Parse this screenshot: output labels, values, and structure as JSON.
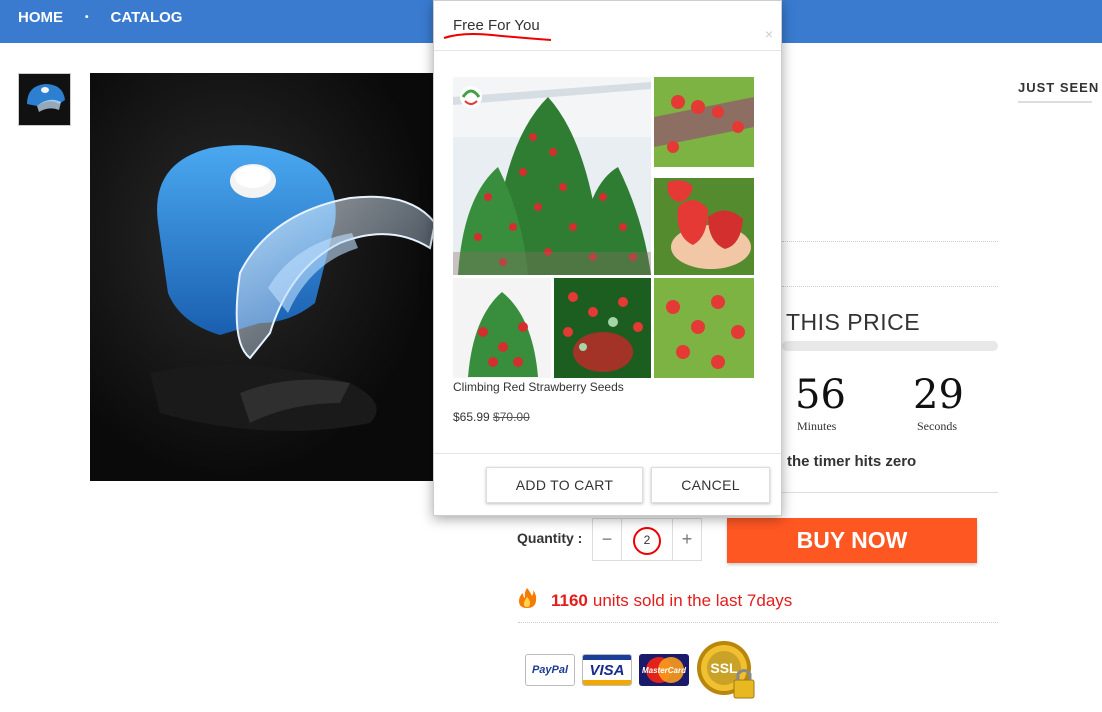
{
  "nav": {
    "home": "HOME",
    "separator": "•",
    "catalog": "CATALOG"
  },
  "sidebar": {
    "just_seen": "JUST SEEN"
  },
  "promo": {
    "title": "THIS PRICE",
    "timer": [
      {
        "value": "56",
        "label": "Minutes"
      },
      {
        "value": "29",
        "label": "Seconds"
      }
    ],
    "note": "the timer hits zero"
  },
  "quantity": {
    "label": "Quantity :",
    "minus": "−",
    "value": "2",
    "plus": "+"
  },
  "buy_button": "BUY NOW",
  "sold": {
    "count": "1160",
    "text": "units sold in the last 7days"
  },
  "payment_badges": {
    "paypal": "PayPal",
    "visa": "VISA",
    "mastercard": "MasterCard",
    "ssl": "SSL"
  },
  "modal": {
    "title": "Free For You",
    "close": "×",
    "product_name": "Climbing Red Strawberry Seeds",
    "price": "$65.99",
    "old_price": "$70.00",
    "add_to_cart": "ADD TO CART",
    "cancel": "CANCEL"
  },
  "colors": {
    "nav_bg": "#3a7bd0",
    "buy_button": "#ff5722",
    "sold_text": "#e31c1c",
    "annotation": "#e00000"
  }
}
